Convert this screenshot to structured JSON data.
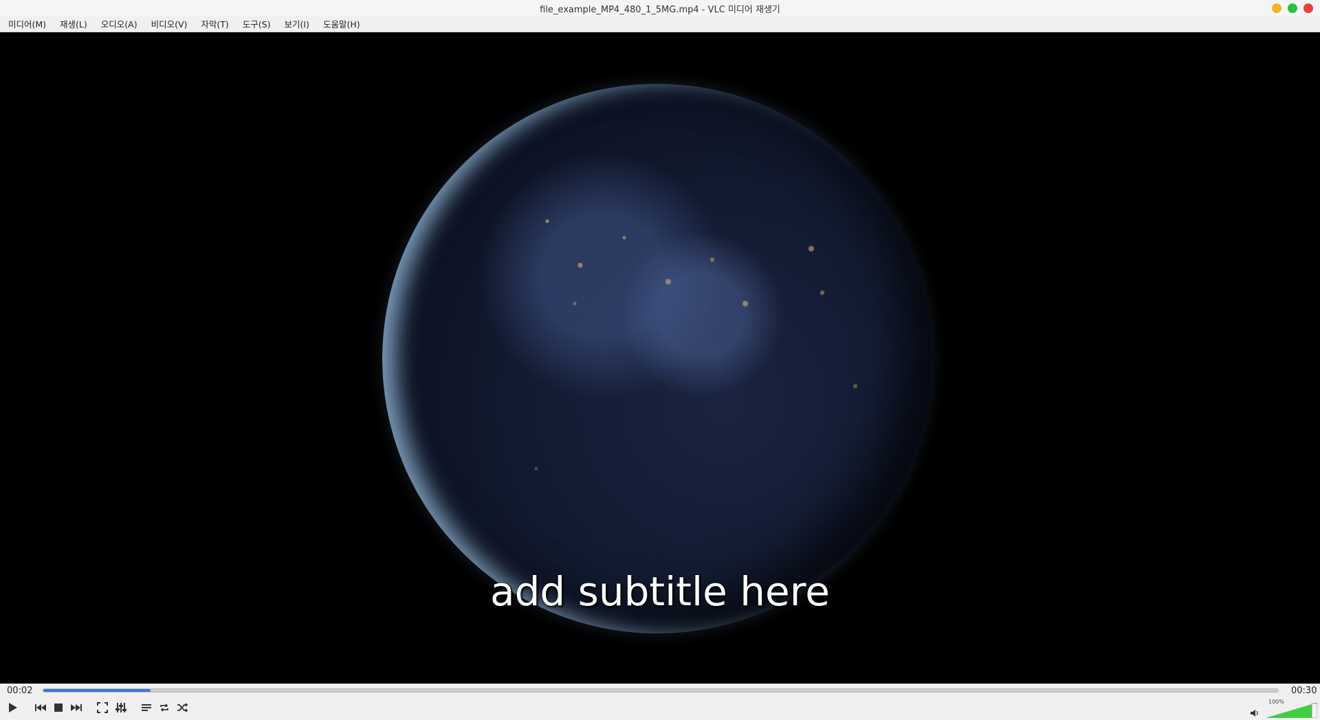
{
  "window": {
    "title": "file_example_MP4_480_1_5MG.mp4 - VLC 미디어 재생기",
    "buttons": [
      {
        "name": "minimize",
        "color": "#f5b324"
      },
      {
        "name": "maximize",
        "color": "#29c140"
      },
      {
        "name": "close",
        "color": "#e8413b"
      }
    ]
  },
  "menu": {
    "items": [
      {
        "label": "미디어(M)"
      },
      {
        "label": "재생(L)"
      },
      {
        "label": "오디오(A)"
      },
      {
        "label": "비디오(V)"
      },
      {
        "label": "자막(T)"
      },
      {
        "label": "도구(S)"
      },
      {
        "label": "보기(I)"
      },
      {
        "label": "도움말(H)"
      }
    ]
  },
  "video": {
    "subtitle": "add subtitle here"
  },
  "playback": {
    "elapsed": "00:02",
    "total": "00:30",
    "progress_fraction": 0.0867
  },
  "controls": {
    "icons": [
      "play-icon",
      "previous-icon",
      "stop-icon",
      "next-icon",
      "fullscreen-icon",
      "extended-settings-icon",
      "playlist-icon",
      "loop-icon",
      "shuffle-icon"
    ]
  },
  "volume": {
    "label": "100%",
    "level_fraction": 1.0,
    "fill_color": "#3fcf3f"
  },
  "colors": {
    "accent": "#3c79d6"
  }
}
